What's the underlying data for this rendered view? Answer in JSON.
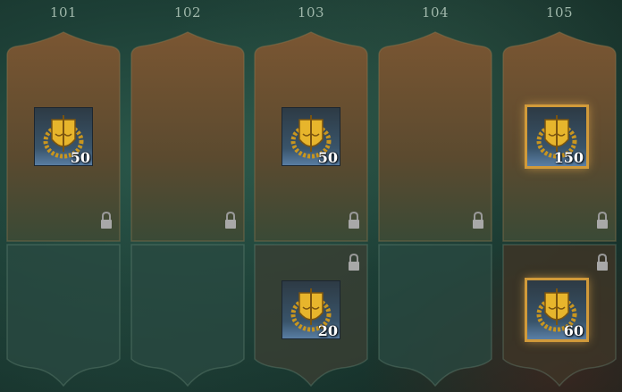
{
  "columns": [
    {
      "level": "101",
      "top": {
        "quantity": "50",
        "highlighted": false
      },
      "bottom": null
    },
    {
      "level": "102",
      "top": null,
      "bottom": null
    },
    {
      "level": "103",
      "top": {
        "quantity": "50",
        "highlighted": false
      },
      "bottom": {
        "quantity": "20",
        "highlighted": false
      }
    },
    {
      "level": "104",
      "top": null,
      "bottom": null
    },
    {
      "level": "105",
      "top": {
        "quantity": "150",
        "highlighted": true
      },
      "bottom": {
        "quantity": "60",
        "highlighted": true
      }
    }
  ],
  "icons": {
    "reward": "gold-crest-emblem-icon",
    "lock": "padlock-icon"
  },
  "colors": {
    "background": "#1d3f36",
    "track_premium": "#6b4a2a",
    "track_free": "#2a4a42",
    "highlight_border": "#d19a3a"
  }
}
